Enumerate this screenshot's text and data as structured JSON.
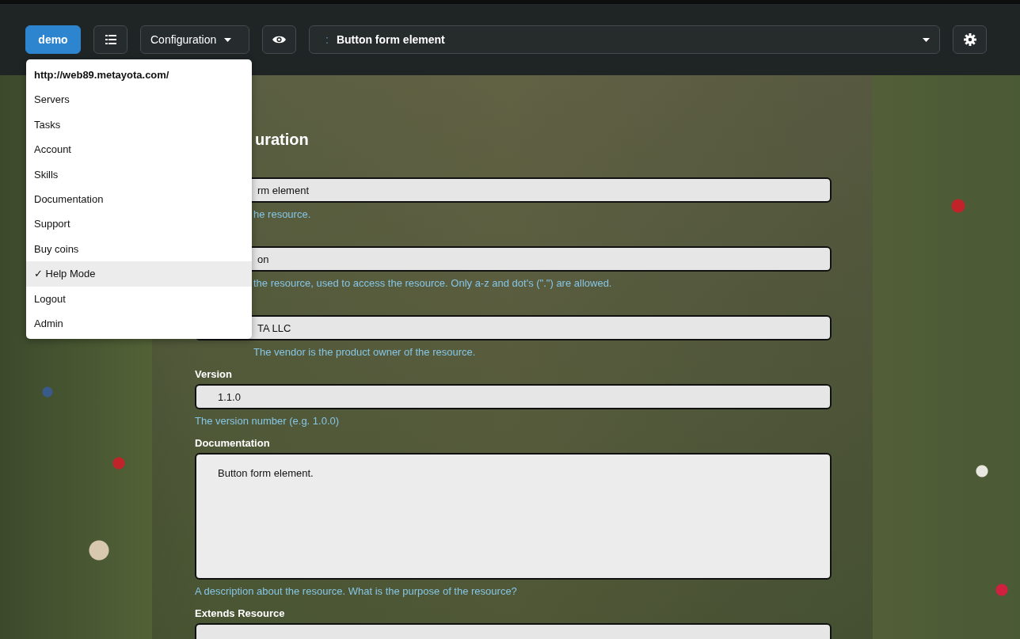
{
  "topbar": {
    "user_button": "demo",
    "view_menu": {
      "label": "Configuration"
    },
    "resource_select": {
      "prefix": ":",
      "value": "Button form element"
    }
  },
  "user_menu": {
    "open": true,
    "items": [
      {
        "kind": "header",
        "label": "http://web89.metayota.com/",
        "selected": false
      },
      {
        "kind": "item",
        "label": "Servers",
        "selected": false
      },
      {
        "kind": "item",
        "label": "Tasks",
        "selected": false
      },
      {
        "kind": "item",
        "label": "Account",
        "selected": false
      },
      {
        "kind": "item",
        "label": "Skills",
        "selected": false
      },
      {
        "kind": "item",
        "label": "Documentation",
        "selected": false
      },
      {
        "kind": "item",
        "label": "Support",
        "selected": false
      },
      {
        "kind": "item",
        "label": "Buy coins",
        "selected": false
      },
      {
        "kind": "item",
        "label": "Help Mode",
        "check": "✓",
        "selected": true
      },
      {
        "kind": "item",
        "label": "Logout",
        "selected": false
      },
      {
        "kind": "item",
        "label": "Admin",
        "selected": false
      }
    ]
  },
  "form": {
    "title": "uration",
    "fields": [
      {
        "kind": "input",
        "value": "rm element",
        "hint": "he resource."
      },
      {
        "kind": "input",
        "value": "on",
        "hint": "the resource, used to access the resource. Only a-z and dot's (\".\") are allowed."
      },
      {
        "kind": "input",
        "value": "TA LLC",
        "hint": "The vendor is the product owner of the resource."
      },
      {
        "kind": "input",
        "label": "Version",
        "value": "1.1.0",
        "hint": "The version number (e.g. 1.0.0)"
      },
      {
        "kind": "textarea",
        "label": "Documentation",
        "value": "Button form element.",
        "hint": "A description about the resource. What is the purpose of the resource?"
      },
      {
        "kind": "input",
        "label": "Extends Resource"
      }
    ]
  }
}
